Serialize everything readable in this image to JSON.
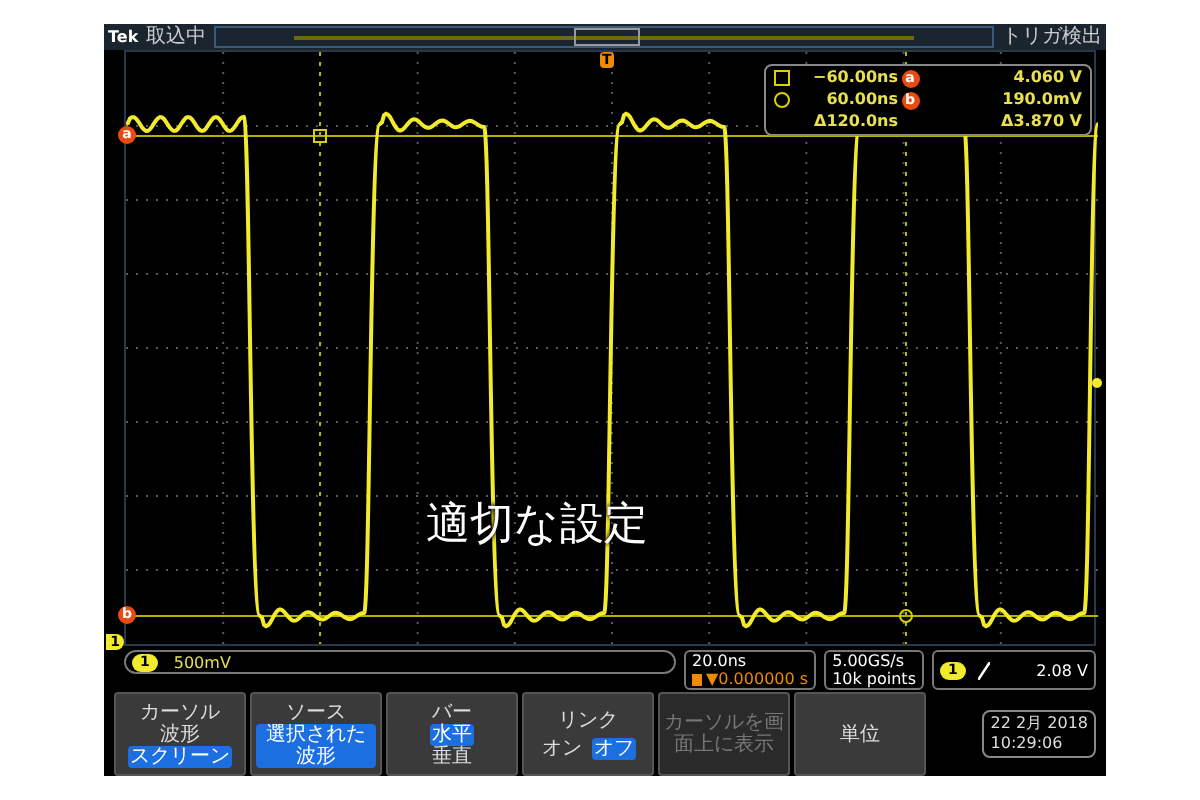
{
  "header": {
    "brand": "Tek",
    "status": "取込中",
    "trigger_status": "トリガ検出"
  },
  "display": {
    "trigger_marker": "T",
    "cursor_a_label": "a",
    "cursor_b_label": "b",
    "channel_marker": "1",
    "overlay_text": "適切な設定"
  },
  "cursor_readout": [
    {
      "time": "−60.00ns",
      "marker": "a",
      "voltage": "4.060 V"
    },
    {
      "time": "60.00ns",
      "marker": "b",
      "voltage": "190.0mV"
    },
    {
      "time": "Δ120.0ns",
      "voltage": "Δ3.870 V"
    }
  ],
  "status": {
    "channel": "1",
    "scale": "500mV",
    "timebase": "20.0ns",
    "trigger_position": "▼0.000000 s",
    "sample_rate": "5.00GS/s",
    "record_length": "10k points",
    "trigger_channel": "1",
    "trigger_level": "2.08 V"
  },
  "menu": [
    {
      "kind": "stacked",
      "label": "カーソル",
      "disabled": false,
      "options": [
        {
          "text": "波形",
          "selected": false
        },
        {
          "text": "スクリーン",
          "selected": true
        }
      ]
    },
    {
      "kind": "stacked",
      "label": "ソース",
      "disabled": false,
      "options": [
        {
          "text": "選択された波形",
          "selected": true
        }
      ]
    },
    {
      "kind": "stacked",
      "label": "バー",
      "disabled": false,
      "options": [
        {
          "text": "水平",
          "selected": true
        },
        {
          "text": "垂直",
          "selected": false
        }
      ]
    },
    {
      "kind": "inline",
      "label": "リンク",
      "disabled": false,
      "options": [
        {
          "text": "オン",
          "selected": false
        },
        {
          "text": "オフ",
          "selected": true
        }
      ]
    },
    {
      "kind": "stacked",
      "label": "カーソルを画面上に表示",
      "disabled": true
    },
    {
      "kind": "stacked",
      "label": "単位",
      "disabled": false
    }
  ],
  "clock": {
    "date": "22 2月 2018",
    "time": "10:29:06"
  }
}
